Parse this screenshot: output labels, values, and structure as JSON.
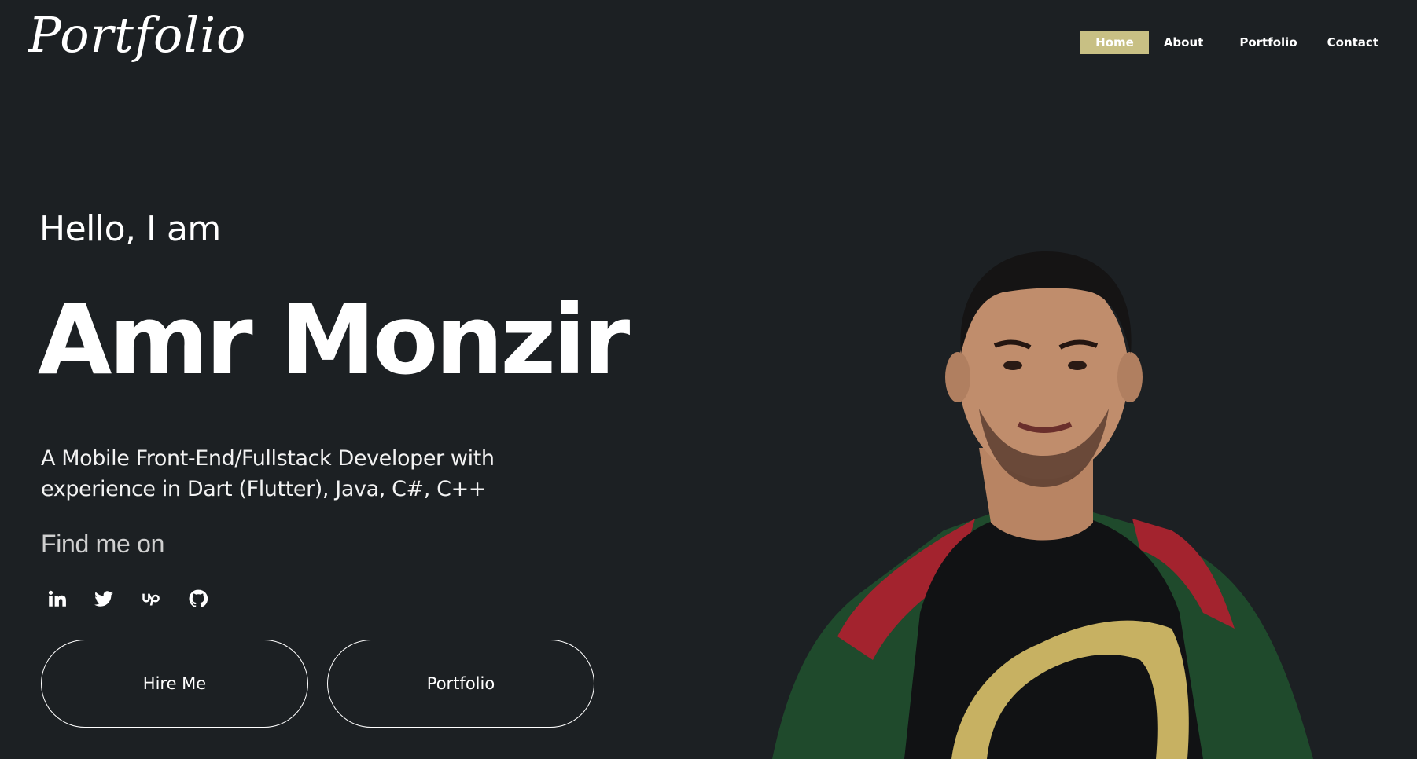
{
  "header": {
    "logo": "Portfolio",
    "nav": {
      "home": "Home",
      "about": "About",
      "portfolio": "Portfolio",
      "contact": "Contact"
    }
  },
  "hero": {
    "greeting": "Hello, I am",
    "name": "Amr Monzir",
    "tagline_line1": "A Mobile Front-End/Fullstack Developer with",
    "tagline_line2": "experience in Dart (Flutter), Java, C#, C++",
    "find_me": "Find me on",
    "socials": [
      "linkedin-icon",
      "twitter-icon",
      "upwork-icon",
      "github-icon"
    ],
    "buttons": {
      "hire": "Hire Me",
      "portfolio": "Portfolio"
    }
  },
  "colors": {
    "background": "#1c2023",
    "accent": "#c8c084",
    "text": "#ffffff"
  }
}
